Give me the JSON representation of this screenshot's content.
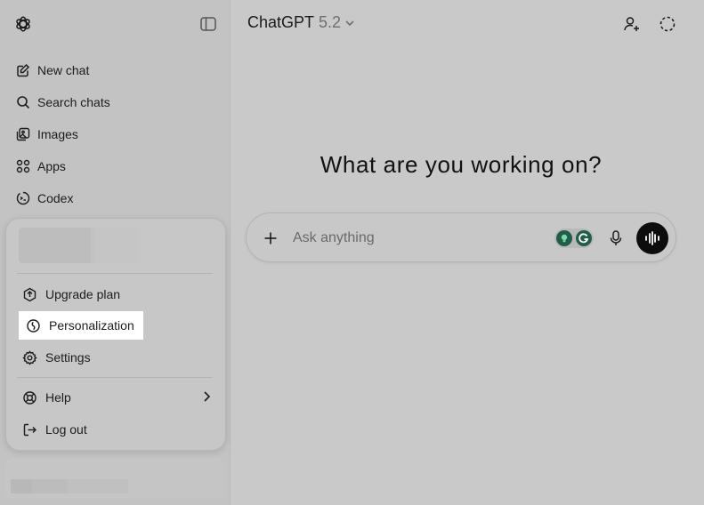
{
  "sidebar": {
    "logo_icon": "openai-logo-icon",
    "toggle_icon": "sidebar-toggle-icon",
    "items": [
      {
        "label": "New chat",
        "icon": "edit-icon"
      },
      {
        "label": "Search chats",
        "icon": "search-icon"
      },
      {
        "label": "Images",
        "icon": "images-icon"
      },
      {
        "label": "Apps",
        "icon": "apps-icon"
      },
      {
        "label": "Codex",
        "icon": "codex-icon"
      }
    ]
  },
  "profile_menu": {
    "items": [
      {
        "label": "Upgrade plan",
        "icon": "upgrade-icon"
      },
      {
        "label": "Personalization",
        "icon": "personalization-icon",
        "highlighted": true
      },
      {
        "label": "Settings",
        "icon": "gear-icon"
      },
      {
        "label": "Help",
        "icon": "help-icon",
        "has_submenu": true
      },
      {
        "label": "Log out",
        "icon": "logout-icon"
      }
    ]
  },
  "header": {
    "model_name": "ChatGPT",
    "model_version": "5.2",
    "right_icons": [
      "add-person-icon",
      "temporary-chat-icon"
    ]
  },
  "main": {
    "heading": "What are you working on?",
    "composer": {
      "placeholder": "Ask anything"
    }
  },
  "colors": {
    "highlight": "#ffffff",
    "voice_button": "#0d0d0d",
    "extension": "#1f5e4a"
  }
}
